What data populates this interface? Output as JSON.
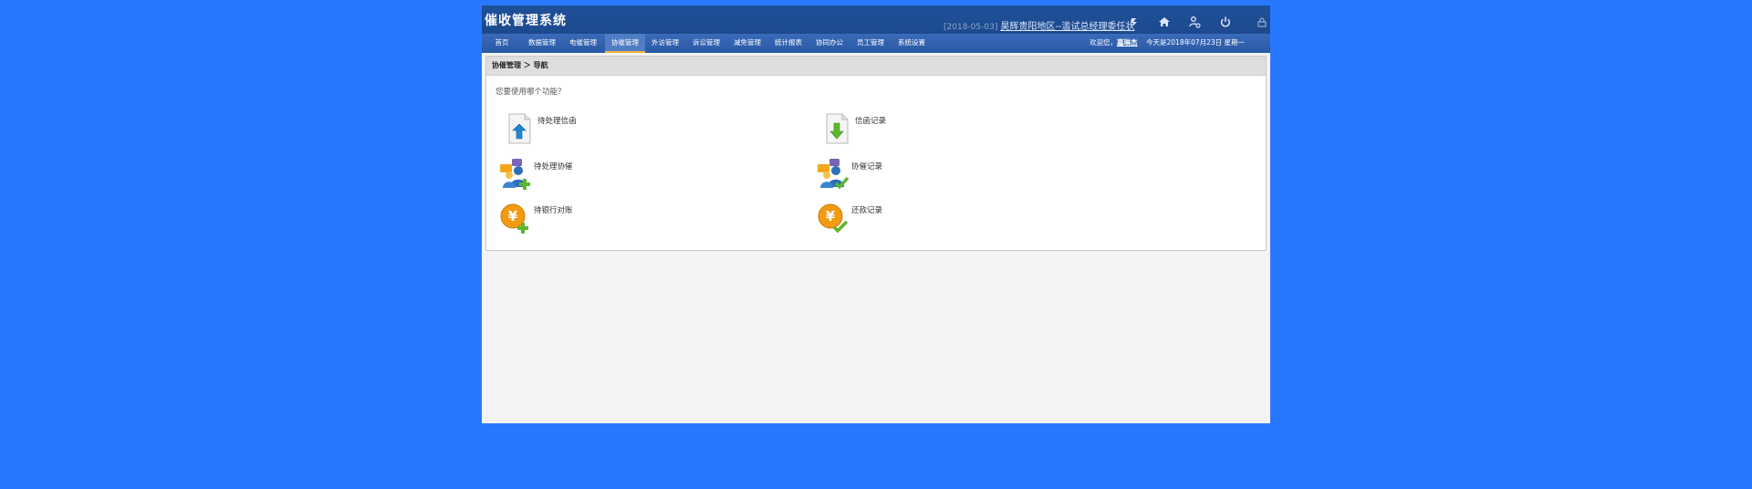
{
  "header": {
    "title": "催收管理系统",
    "notice_date": "[2018-05-03]",
    "notice_text": "昊辉贵阳地区--滥试总经理委任状",
    "icons": [
      "refresh-icon",
      "home-icon",
      "user-settings-icon",
      "power-icon",
      "lock-icon"
    ]
  },
  "nav": {
    "items": [
      {
        "label": "首页"
      },
      {
        "label": "数据管理"
      },
      {
        "label": "电催管理"
      },
      {
        "label": "协催管理"
      },
      {
        "label": "外访管理"
      },
      {
        "label": "诉讼管理"
      },
      {
        "label": "减免管理"
      },
      {
        "label": "统计报表"
      },
      {
        "label": "协同办公"
      },
      {
        "label": "员工管理"
      },
      {
        "label": "系统设置"
      }
    ],
    "active": "协催管理",
    "welcome_prefix": "欢迎您，",
    "user_name": "嘉琳杰",
    "today": "今天是2018年07月23日 星期一"
  },
  "main": {
    "breadcrumb": "协催管理 ＞ 导航",
    "prompt": "您要使用哪个功能？",
    "functions": [
      {
        "label": "待处理信函",
        "icon": "letter-upload-icon"
      },
      {
        "label": "信函记录",
        "icon": "letter-download-icon"
      },
      {
        "label": "待处理协催",
        "icon": "users-add-icon"
      },
      {
        "label": "协催记录",
        "icon": "users-check-icon"
      },
      {
        "label": "待银行对账",
        "icon": "yen-add-icon"
      },
      {
        "label": "还款记录",
        "icon": "yen-check-icon"
      }
    ]
  },
  "colors": {
    "page_background": "#2878ff",
    "header": "#1f5098",
    "nav": "#2f5fae",
    "active_tab_underline": "#f2b33a"
  }
}
